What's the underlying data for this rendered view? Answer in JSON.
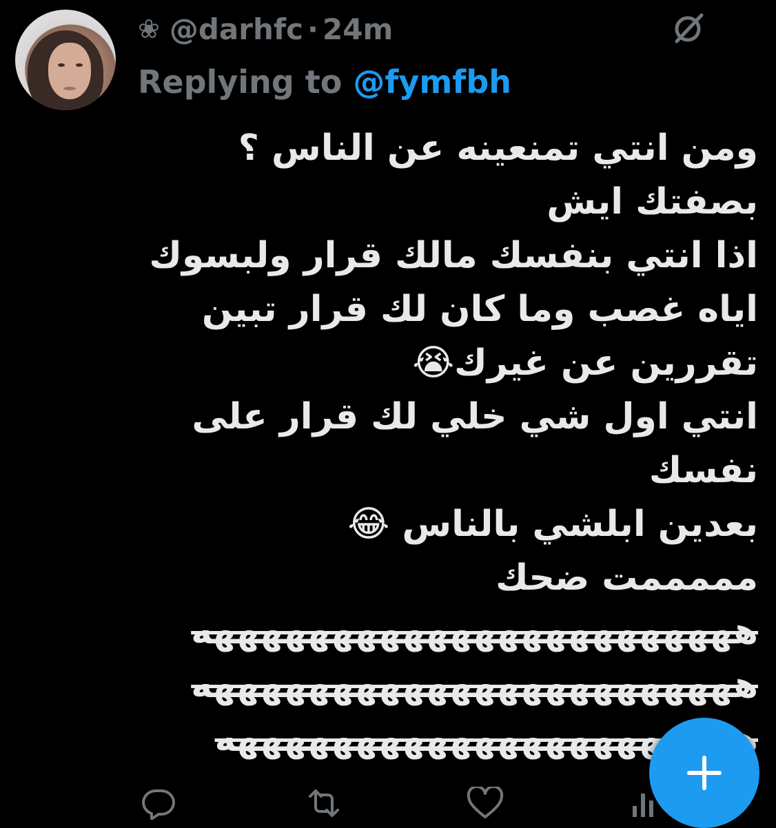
{
  "tweet": {
    "display_icon": "❀",
    "handle": "@darhfc",
    "separator": "·",
    "timestamp": "24m",
    "replying_prefix": "Replying to ",
    "replying_handle": "@fymfbh",
    "lines": [
      "ومن انتي تمنعينه عن الناس ؟",
      "بصفتك ايش",
      "اذا انتي بنفسك مالك قرار ولبسوك",
      "اياه غصب وما كان لك قرار تبين",
      "تقررين عن غيرك😭",
      "انتي اول شي خلي لك قرار على",
      "نفسك",
      "بعدين ابلشي بالناس 😂",
      "مممممت ضحك",
      "هههههههههههههههههههههههه",
      "هههههههههههههههههههههههه",
      "ههههههههههههههههههههههه"
    ]
  },
  "icons": {
    "avatar": "avatar",
    "more": "grok-slash-icon",
    "reply": "reply-icon",
    "retweet": "retweet-icon",
    "like": "like-icon",
    "compose": "compose-plus-icon"
  },
  "colors": {
    "background": "#000000",
    "text": "#e7e9ea",
    "muted": "#71767b",
    "accent": "#1d9bf0"
  }
}
